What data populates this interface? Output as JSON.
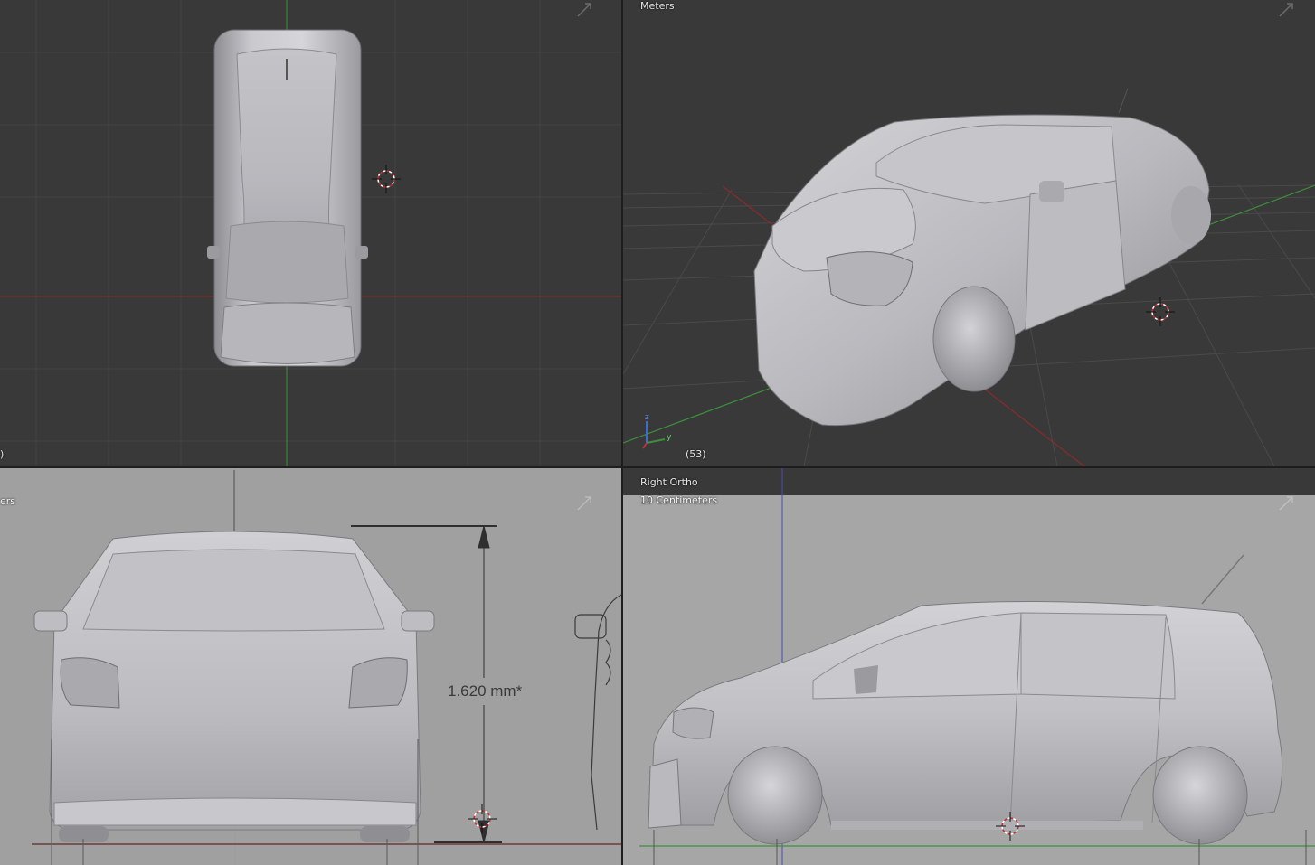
{
  "viewports": {
    "top_left": {
      "corner_label": ")"
    },
    "top_right": {
      "scale_label": "Meters",
      "frame_label": "(53)",
      "axis_labels": {
        "z": "z",
        "y": "y"
      }
    },
    "bottom_left": {
      "scale_label": "ers",
      "dimension_text": "1.620 mm*"
    },
    "bottom_right": {
      "view_name": "Right Ortho",
      "scale_label": "10 Centimeters"
    }
  },
  "colors": {
    "viewport_dark": "#393939",
    "grid_line": "#444444",
    "x_axis": "#8b2b2b",
    "y_axis": "#3c8f3c",
    "reference_bg": "#a0a0a0",
    "car_body": "#c8c8cc"
  },
  "icons": [
    "view-maximize-icon",
    "3d-cursor-icon",
    "axis-gizmo-icon"
  ]
}
